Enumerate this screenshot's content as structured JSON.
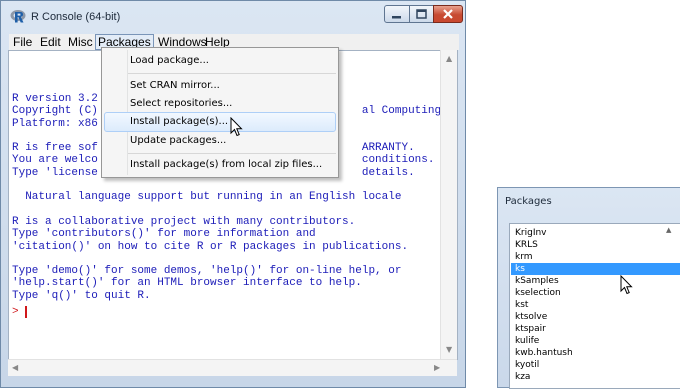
{
  "console_window": {
    "title": "R Console (64-bit)",
    "menu": [
      "File",
      "Edit",
      "Misc",
      "Packages",
      "Windows",
      "Help"
    ],
    "lines": [
      "R version 3.2",
      "Copyright (C)                                        al Computing",
      "Platform: x86",
      "",
      "R is free sof                                        ARRANTY.",
      "You are welco                                        conditions.",
      "Type 'license                                        details.",
      "",
      "  Natural language support but running in an English locale",
      "",
      "R is a collaborative project with many contributors.",
      "Type 'contributors()' for more information and",
      "'citation()' on how to cite R or R packages in publications.",
      "",
      "Type 'demo()' for some demos, 'help()' for on-line help, or",
      "'help.start()' for an HTML browser interface to help.",
      "Type 'q()' to quit R."
    ],
    "prompt": ">",
    "colors": {
      "text": "#1c1cb8",
      "prompt": "#d0171b"
    }
  },
  "packages_menu": {
    "items": [
      "Load package...",
      "Set CRAN mirror...",
      "Select repositories...",
      "Install package(s)...",
      "Update packages...",
      "Install package(s) from local zip files..."
    ],
    "highlighted": "Install package(s)..."
  },
  "packages_dialog": {
    "title": "Packages",
    "items": [
      "KrigInv",
      "KRLS",
      "krm",
      "ks",
      "kSamples",
      "kselection",
      "kst",
      "ktsolve",
      "ktspair",
      "kulife",
      "kwb.hantush",
      "kyotil",
      "kza"
    ],
    "selected": "ks",
    "colors": {
      "selection": "#3399ff"
    }
  }
}
